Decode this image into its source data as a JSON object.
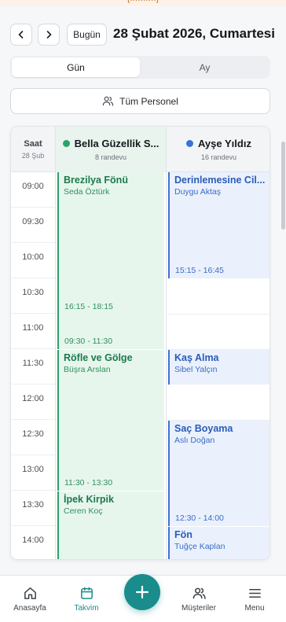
{
  "banner": {
    "text": "[..........]"
  },
  "header": {
    "prev_icon": "chevron-left-icon",
    "next_icon": "chevron-right-icon",
    "today_label": "Bugün",
    "date_title": "28 Şubat 2026, Cumartesi"
  },
  "view_toggle": {
    "day_label": "Gün",
    "month_label": "Ay",
    "selected": "Gün"
  },
  "staff_filter": {
    "icon": "users-icon",
    "label": "Tüm Personel"
  },
  "calendar": {
    "time_header": {
      "title": "Saat",
      "date": "28 Şub"
    },
    "times": [
      "09:00",
      "09:30",
      "10:00",
      "10:30",
      "11:00",
      "11:30",
      "12:00",
      "12:30",
      "13:00",
      "13:30",
      "14:00"
    ],
    "staff": [
      {
        "name": "Bella Güzellik S...",
        "count": "8 randevu",
        "color": "#2aa36a",
        "appointments": [
          {
            "service": "Brezilya Fönü",
            "customer": "Seda Öztürk",
            "time": "09:30 - 11:30",
            "start": "09:00",
            "end": "11:30"
          },
          {
            "service": "Röfle ve Gölge",
            "customer": "Büşra Arslan",
            "time": "11:30 - 13:30",
            "start": "11:30",
            "end": "13:30"
          },
          {
            "service": "İpek Kirpik",
            "customer": "Ceren Koç",
            "time": "",
            "start": "13:30",
            "end": "14:30"
          }
        ]
      },
      {
        "name": "Ayşe Yıldız",
        "count": "16 randevu",
        "color": "#3b73d4",
        "appointments": [
          {
            "service": "Derinlemesine Cil...",
            "customer": "Duygu Aktaş",
            "time": "15:15 - 16:45",
            "start": "09:00",
            "end": "10:30"
          },
          {
            "service": "Kaş Alma",
            "customer": "Sibel Yalçın",
            "time": "",
            "start": "11:30",
            "end": "12:00"
          },
          {
            "service": "Saç Boyama",
            "customer": "Aslı Doğan",
            "time": "12:30 - 14:00",
            "start": "12:30",
            "end": "14:00"
          },
          {
            "service": "Fön",
            "customer": "Tuğçe Kaplan",
            "time": "",
            "start": "14:00",
            "end": "14:30"
          }
        ]
      }
    ],
    "overlap_label": "16:15 - 18:15"
  },
  "bottom_nav": {
    "items": [
      {
        "label": "Anasayfa",
        "icon": "home-icon"
      },
      {
        "label": "Takvim",
        "icon": "calendar-icon",
        "active": true
      },
      {
        "label": "Müşteriler",
        "icon": "users-icon"
      },
      {
        "label": "Menu",
        "icon": "menu-icon"
      }
    ],
    "fab_icon": "plus-icon"
  },
  "colors": {
    "accent": "#1a8c8c",
    "green": "#2aa36a",
    "blue": "#3b73d4"
  }
}
